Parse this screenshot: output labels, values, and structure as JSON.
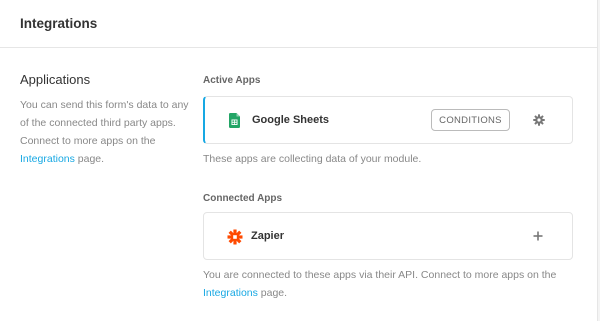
{
  "header": {
    "title": "Integrations"
  },
  "left": {
    "heading": "Applications",
    "text_before": "You can send this form's data to any of the connected third party apps. Connect to more apps on the ",
    "link": "Integrations",
    "text_after": " page."
  },
  "active": {
    "label": "Active Apps",
    "app": {
      "name": "Google Sheets",
      "icon": "google-sheets-icon",
      "button": "CONDITIONS"
    },
    "desc": "These apps are collecting data of your module."
  },
  "connected": {
    "label": "Connected Apps",
    "app": {
      "name": "Zapier",
      "icon": "zapier-icon"
    },
    "desc_before": "You are connected to these apps via their API. Connect to more apps on the ",
    "link": "Integrations",
    "desc_after": " page."
  },
  "colors": {
    "accent": "#17a8e3",
    "sheets": "#23a566",
    "zapier": "#ff4a00"
  }
}
